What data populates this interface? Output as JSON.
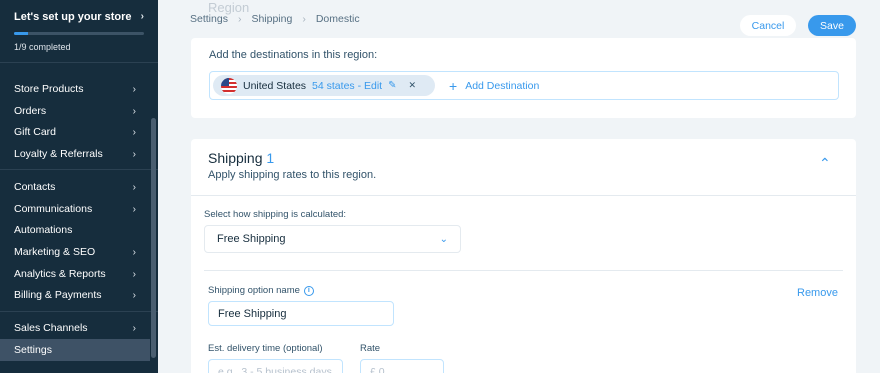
{
  "sidebar": {
    "setup_title": "Let's set up your store",
    "setup_progress_text": "1/9 completed",
    "setup_progress": 0.111,
    "items": [
      {
        "label": "Store Products",
        "chevron": true
      },
      {
        "label": "Orders",
        "chevron": true
      },
      {
        "label": "Gift Card",
        "chevron": true
      },
      {
        "label": "Loyalty & Referrals",
        "chevron": true
      },
      {
        "label": "Contacts",
        "chevron": true
      },
      {
        "label": "Communications",
        "chevron": true
      },
      {
        "label": "Automations",
        "chevron": false
      },
      {
        "label": "Marketing & SEO",
        "chevron": true
      },
      {
        "label": "Analytics & Reports",
        "chevron": true
      },
      {
        "label": "Billing & Payments",
        "chevron": true
      },
      {
        "label": "Sales Channels",
        "chevron": true
      },
      {
        "label": "Settings",
        "chevron": false,
        "active": true
      }
    ]
  },
  "breadcrumb": [
    "Settings",
    "Shipping",
    "Domestic"
  ],
  "toolbar": {
    "cancel_label": "Cancel",
    "save_label": "Save"
  },
  "region": {
    "peek_title": "Region",
    "destinations_label": "Add the destinations in this region:",
    "chip": {
      "country": "United States",
      "states_edit": "54 states - Edit"
    },
    "add_destination_label": "Add Destination"
  },
  "shipping": {
    "title": "Shipping",
    "count": "1",
    "subtitle": "Apply shipping rates to this region.",
    "calc_label": "Select how shipping is calculated:",
    "calc_value": "Free Shipping",
    "option_name_label": "Shipping option name",
    "remove_label": "Remove",
    "option_name_value": "Free Shipping",
    "delivery_label": "Est. delivery time (optional)",
    "delivery_placeholder": "e.g., 3 - 5 business days",
    "rate_label": "Rate",
    "rate_placeholder": "£ 0"
  },
  "colors": {
    "accent": "#3899ec",
    "sidebar_bg": "#162d3d",
    "page_bg": "#f0f4f7"
  }
}
